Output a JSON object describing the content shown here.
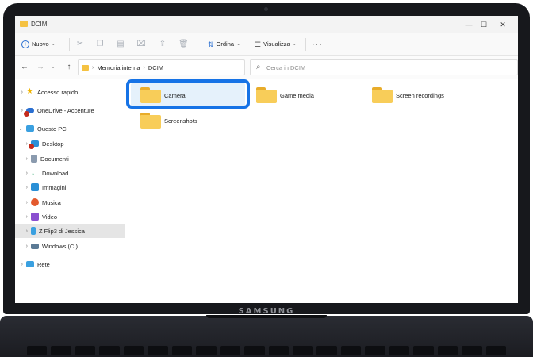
{
  "device": {
    "brand": "SAMSUNG"
  },
  "window": {
    "title": "DCIM",
    "controls": {
      "minimize": "—",
      "maximize": "☐",
      "close": "✕"
    }
  },
  "toolbar": {
    "new_label": "Nuovo",
    "order_label": "Ordina",
    "view_label": "Visualizza",
    "more_label": "···"
  },
  "address": {
    "path": [
      "Memoria interna",
      "DCIM"
    ],
    "separator": "›"
  },
  "search": {
    "placeholder": "Cerca in DCIM",
    "value": ""
  },
  "sidebar": {
    "items": [
      {
        "label": "Accesso rapido",
        "icon": "star-icon",
        "color": "#f0b400"
      },
      {
        "label": "OneDrive - Accenture",
        "icon": "cloud-icon",
        "color": "#2a6fd1"
      },
      {
        "label": "Questo PC",
        "icon": "computer-icon",
        "color": "#3aa0e0"
      },
      {
        "label": "Desktop",
        "icon": "desktop-icon",
        "color": "#2a8fd6"
      },
      {
        "label": "Documenti",
        "icon": "document-icon",
        "color": "#8a9aae"
      },
      {
        "label": "Download",
        "icon": "download-icon",
        "color": "#2aa36b"
      },
      {
        "label": "Immagini",
        "icon": "image-icon",
        "color": "#2a8fd6"
      },
      {
        "label": "Musica",
        "icon": "music-icon",
        "color": "#e35a2e"
      },
      {
        "label": "Video",
        "icon": "video-icon",
        "color": "#8a4fd0"
      },
      {
        "label": "Z Flip3 di Jessica",
        "icon": "phone-icon",
        "color": "#3aa0e0"
      },
      {
        "label": "Windows (C:)",
        "icon": "drive-icon",
        "color": "#5b7a95"
      },
      {
        "label": "Rete",
        "icon": "network-icon",
        "color": "#3aa0e0"
      }
    ]
  },
  "folders": [
    {
      "label": "Camera"
    },
    {
      "label": "Game media"
    },
    {
      "label": "Screen recordings"
    },
    {
      "label": "Screenshots"
    }
  ],
  "colors": {
    "accent": "#1673e6",
    "folder": "#f8cd59",
    "selection": "#e5f1fb"
  }
}
